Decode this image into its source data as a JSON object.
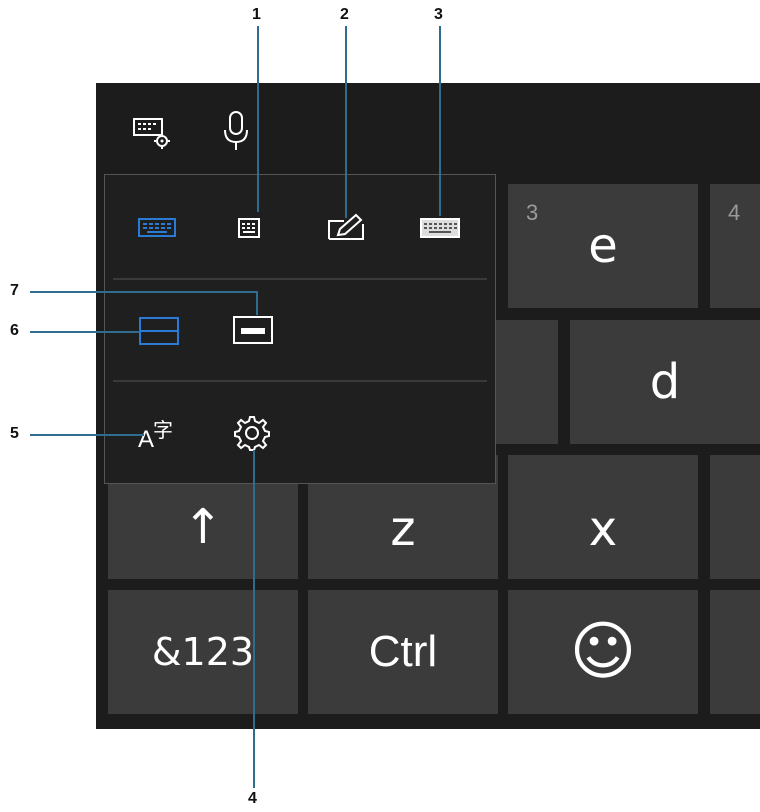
{
  "callouts": {
    "c1": "1",
    "c2": "2",
    "c3": "3",
    "c4": "4",
    "c5": "5",
    "c6": "6",
    "c7": "7"
  },
  "keys": {
    "e_hint": "3",
    "e": "e",
    "r_hint": "4",
    "d": "d",
    "shift_arrow": "↑",
    "z": "z",
    "x": "x",
    "symbols": "&123",
    "ctrl": "Ctrl",
    "emoji": "☺"
  },
  "menu": {
    "language_glyph_a": "A",
    "language_glyph_char": "字"
  },
  "colors": {
    "accent_blue": "#2a7bd6",
    "key_bg": "#3b3b3b",
    "frame_bg": "#1c1c1c"
  },
  "icons": {
    "keyboard_settings": "keyboard-settings-icon",
    "microphone": "microphone-icon",
    "default_keyboard": "default-keyboard-icon",
    "onehanded_keyboard": "onehanded-keyboard-icon",
    "handwriting": "handwriting-pen-icon",
    "full_keyboard": "full-keyboard-icon",
    "docked": "docked-keyboard-icon",
    "undocked": "undocked-keyboard-icon",
    "language": "language-icon",
    "settings": "gear-icon"
  }
}
